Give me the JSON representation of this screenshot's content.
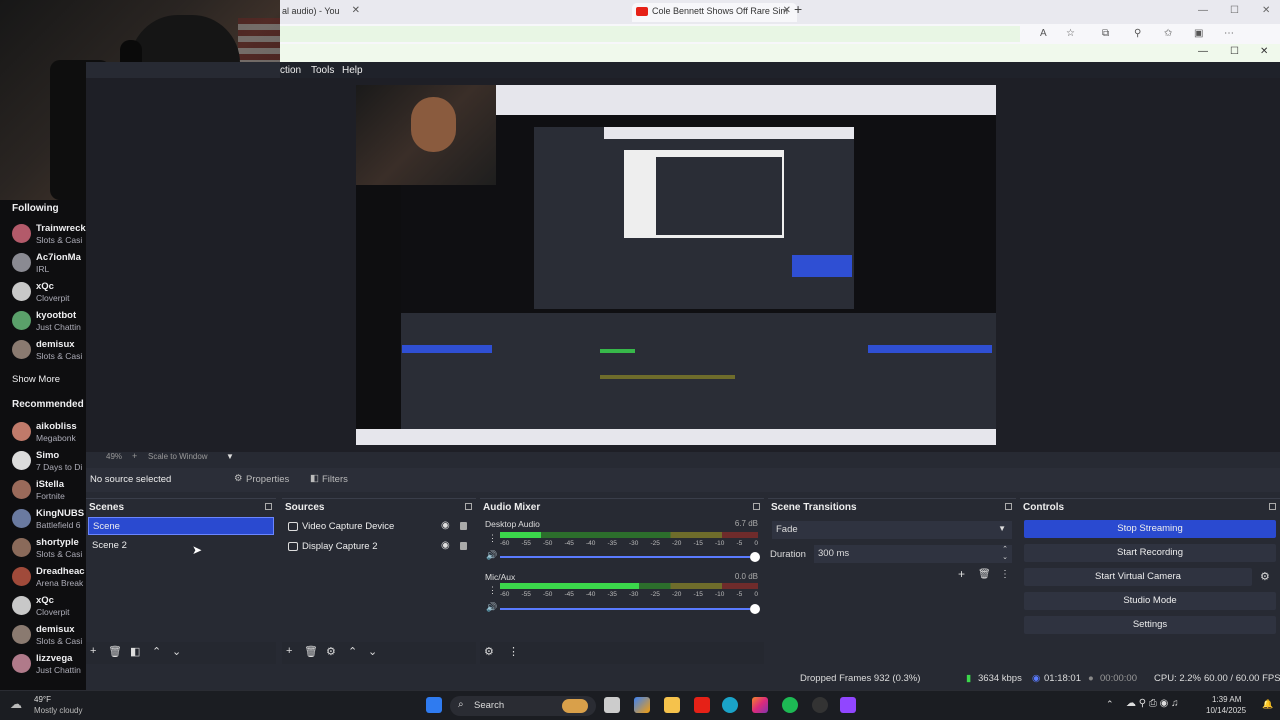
{
  "browser": {
    "tab1_title": "al audio) - You",
    "tab2_title": "Cole Bennett Shows Off Rare Sim",
    "new_tab": "+"
  },
  "obs": {
    "menu": [
      "ction",
      "Tools",
      "Help"
    ],
    "preview_zoom": "49%",
    "preview_scale": "Scale to Window",
    "no_source": "No source selected",
    "properties_label": "Properties",
    "filters_label": "Filters",
    "docks": {
      "scenes": "Scenes",
      "sources": "Sources",
      "mixer": "Audio Mixer",
      "transitions": "Scene Transitions",
      "controls": "Controls"
    },
    "scenes": [
      "Scene",
      "Scene 2"
    ],
    "sources": [
      "Video Capture Device",
      "Display Capture 2"
    ],
    "mixer": {
      "channels": [
        {
          "name": "Desktop Audio",
          "db": "6.7 dB",
          "level": 0.16
        },
        {
          "name": "Mic/Aux",
          "db": "0.0 dB",
          "level": 0.54
        }
      ],
      "ticks": [
        "-60",
        "-55",
        "-50",
        "-45",
        "-40",
        "-35",
        "-30",
        "-25",
        "-20",
        "-15",
        "-10",
        "-5",
        "0"
      ]
    },
    "transitions": {
      "type": "Fade",
      "duration_label": "Duration",
      "duration_value": "300 ms"
    },
    "controls": {
      "stop_streaming": "Stop Streaming",
      "start_recording": "Start Recording",
      "start_virtual_camera": "Start Virtual Camera",
      "studio_mode": "Studio Mode",
      "settings": "Settings"
    },
    "status": {
      "dropped_frames": "Dropped Frames 932 (0.3%)",
      "bitrate": "3634 kbps",
      "stream_time": "01:18:01",
      "rec_time": "00:00:00",
      "cpu": "CPU: 2.2%",
      "fps": "60.00 / 60.00 FPS"
    }
  },
  "twitch": {
    "following_label": "Following",
    "following": [
      {
        "name": "Trainwreck",
        "game": "Slots & Casi",
        "color": "#b35a6a"
      },
      {
        "name": "Ac7ionMa",
        "game": "IRL",
        "color": "#8a8a92"
      },
      {
        "name": "xQc",
        "game": "Cloverpit",
        "color": "#c8c8c8"
      },
      {
        "name": "kyootbot",
        "game": "Just Chattin",
        "color": "#5aa06a"
      },
      {
        "name": "demisux",
        "game": "Slots & Casi",
        "color": "#8a7a70"
      }
    ],
    "show_more": "Show More",
    "recommended_label": "Recommended",
    "recommended": [
      {
        "name": "aikobliss",
        "game": "Megabonk",
        "color": "#c07a6a"
      },
      {
        "name": "Simo",
        "game": "7 Days to Di",
        "color": "#dcdcdc"
      },
      {
        "name": "iStella",
        "game": "Fortnite",
        "color": "#9a6a5a"
      },
      {
        "name": "KingNUBS",
        "game": "Battlefield 6",
        "color": "#6a7aa0"
      },
      {
        "name": "shortyple",
        "game": "Slots & Casi",
        "color": "#8a6a5a"
      },
      {
        "name": "Dreadheac",
        "game": "Arena Break",
        "color": "#a04a3a"
      },
      {
        "name": "xQc",
        "game": "Cloverpit",
        "color": "#c8c8c8"
      },
      {
        "name": "demisux",
        "game": "Slots & Casi",
        "color": "#8a7a70"
      },
      {
        "name": "lizzvega",
        "game": "Just Chattin",
        "color": "#b07a8a"
      }
    ]
  },
  "taskbar": {
    "weather_temp": "49°F",
    "weather_desc": "Mostly cloudy",
    "search": "Search",
    "time": "1:39 AM",
    "date": "10/14/2025"
  }
}
